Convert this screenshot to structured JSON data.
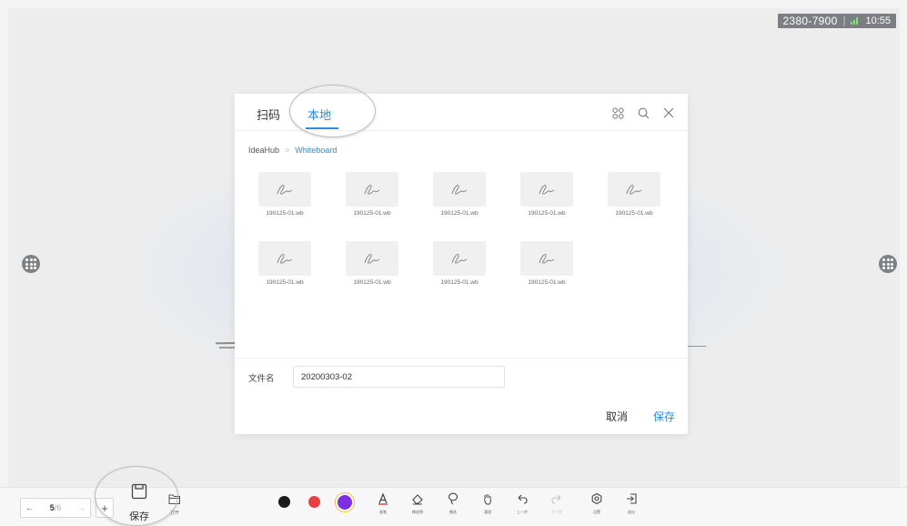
{
  "status_bar": {
    "meeting_id": "2380-7900",
    "time": "10:55"
  },
  "dialog": {
    "tabs": [
      {
        "label": "扫码",
        "active": false
      },
      {
        "label": "本地",
        "active": true
      }
    ],
    "header_icons": [
      "grid-view-icon",
      "search-icon",
      "close-icon"
    ],
    "breadcrumb": {
      "root": "IdeaHub",
      "current": "Whiteboard"
    },
    "files": [
      {
        "name": "190125-01.wb"
      },
      {
        "name": "190125-01.wb"
      },
      {
        "name": "190125-01.wb"
      },
      {
        "name": "190125-01.wb"
      },
      {
        "name": "190125-01.wb"
      },
      {
        "name": "190125-01.wb"
      },
      {
        "name": "190125-01.wb"
      },
      {
        "name": "190125-01.wb"
      },
      {
        "name": "190125-01.wb"
      }
    ],
    "filename_label": "文件名",
    "filename_value": "20200303-02",
    "cancel_label": "取消",
    "save_label": "保存"
  },
  "toolbar": {
    "page_current": "5",
    "page_total": "/6",
    "save_label": "保存",
    "open_label": "打开",
    "colors": [
      "#1a1a1a",
      "#e84040",
      "#7b2fe0"
    ],
    "tools": [
      {
        "label": "画笔",
        "icon": "pen-icon"
      },
      {
        "label": "橡皮擦",
        "icon": "eraser-icon"
      },
      {
        "label": "圈选",
        "icon": "lasso-icon"
      },
      {
        "label": "漫游",
        "icon": "hand-icon"
      },
      {
        "label": "上一步",
        "icon": "undo-icon"
      },
      {
        "label": "下一步",
        "icon": "redo-icon"
      },
      {
        "label": "设置",
        "icon": "settings-icon"
      },
      {
        "label": "退出",
        "icon": "exit-icon"
      }
    ]
  },
  "colors": {
    "accent": "#2a8ae6",
    "background": "#ededee"
  }
}
